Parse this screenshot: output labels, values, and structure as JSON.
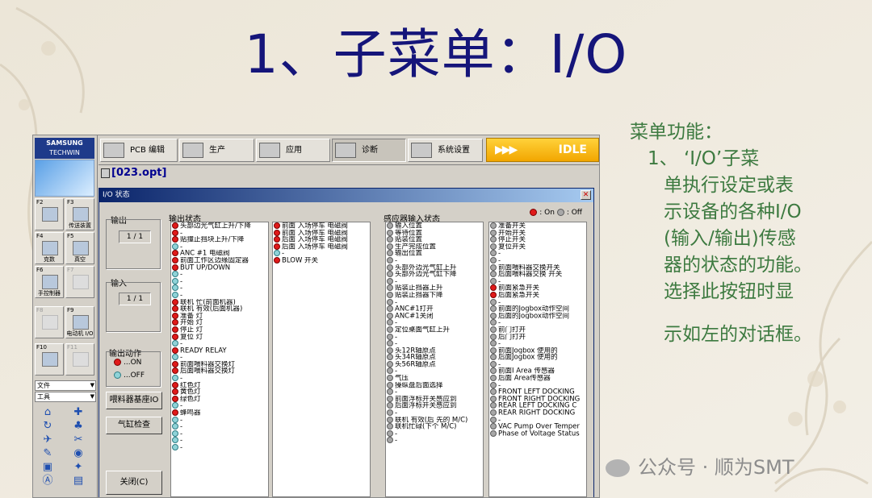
{
  "slide": {
    "title": "1、子菜单：I/O",
    "note_heading": "菜单功能：",
    "note_lines": [
      "1、 ‘I/O’子菜",
      "单执行设定或表",
      "示设备的各种I/O",
      "(输入/输出)传感",
      "器的状态的功能。",
      "选择此按钮时显",
      "示如左的对话框。"
    ],
    "watermark": "公众号 · 顺为SMT"
  },
  "app": {
    "logo_brand": "SAMSUNG",
    "logo_sub": "TECHWIN",
    "file_name": "[023.opt]",
    "status": "IDLE",
    "toolbar": [
      {
        "label": "PCB 编辑",
        "icon": "pcb-edit-icon"
      },
      {
        "label": "生产",
        "icon": "production-icon"
      },
      {
        "label": "应用",
        "icon": "application-icon"
      },
      {
        "label": "诊断",
        "icon": "diagnosis-icon",
        "active": true
      },
      {
        "label": "系统设置",
        "icon": "system-settings-icon"
      }
    ],
    "fkeys": [
      {
        "key": "F2",
        "label": "",
        "disabled": false
      },
      {
        "key": "F3",
        "label": "传送装置",
        "disabled": false
      },
      {
        "key": "F4",
        "label": "克数",
        "disabled": false
      },
      {
        "key": "F5",
        "label": "真空",
        "disabled": false
      },
      {
        "key": "F6",
        "label": "手控制器",
        "disabled": false
      },
      {
        "key": "F7",
        "label": "",
        "disabled": true
      },
      {
        "key": "F8",
        "label": "",
        "disabled": true
      },
      {
        "key": "F9",
        "label": "电动机 I/O",
        "disabled": false
      },
      {
        "key": "F10",
        "label": "",
        "disabled": false
      },
      {
        "key": "F11",
        "label": "",
        "disabled": true
      }
    ],
    "menu_file": "文件",
    "menu_tools": "工具"
  },
  "dialog": {
    "title": "I/O 状态",
    "legend_on": ": On",
    "legend_off": ": Off",
    "output_label": "输出",
    "output_count": "1 / 1",
    "input_label": "输入",
    "input_count": "1 / 1",
    "output_action_label": "输出动作",
    "action_on": "...ON",
    "action_off": "...OFF",
    "feeder_btn": "喂料器基座IO",
    "cylinder_btn": "气缸检查",
    "close_btn": "关闭(C)",
    "output_status_label": "输出状态",
    "sensor_status_label": "感应器输入状态",
    "output_col1": [
      [
        "头部边光气缸上升/下降",
        "on"
      ],
      [
        "-",
        "on"
      ],
      [
        "贴撞止挡块上升/下降",
        "on"
      ],
      [
        "-",
        "off"
      ],
      [
        "ANC #1 电磁阀",
        "on"
      ],
      [
        "前面工作区边缘固定器",
        "on"
      ],
      [
        "BUT UP/DOWN",
        "on"
      ],
      [
        "-",
        "off"
      ],
      [
        "-",
        "off"
      ],
      [
        "-",
        "off"
      ],
      [
        "-",
        "off"
      ],
      [
        "联机 忙(前面机器)",
        "on"
      ],
      [
        "联机 有效(后面机器)",
        "on"
      ],
      [
        "准备 灯",
        "on"
      ],
      [
        "开始 灯",
        "on"
      ],
      [
        "停止 灯",
        "on"
      ],
      [
        "复位 灯",
        "on"
      ],
      [
        "-",
        "off"
      ],
      [
        "READY RELAY",
        "on"
      ],
      [
        "-",
        "off"
      ],
      [
        "前面喂料器交换灯",
        "on"
      ],
      [
        "后面喂料器交换灯",
        "on"
      ],
      [
        "-",
        "off"
      ],
      [
        "红色灯",
        "on"
      ],
      [
        "黄色灯",
        "on"
      ],
      [
        "绿色灯",
        "on"
      ],
      [
        "-",
        "off"
      ],
      [
        "蜂鸣器",
        "on"
      ],
      [
        "-",
        "off"
      ],
      [
        "-",
        "off"
      ],
      [
        "-",
        "off"
      ],
      [
        "-",
        "off"
      ],
      [
        "-",
        "off"
      ]
    ],
    "output_col2": [
      [
        "前面 入场停车 电磁阀",
        "on"
      ],
      [
        "前面 入场停车 电磁阀",
        "on"
      ],
      [
        "后面 入场停车 电磁阀",
        "on"
      ],
      [
        "后面 入场停车 电磁阀",
        "on"
      ],
      [
        "-",
        "off"
      ],
      [
        "BLOW 开关",
        "on"
      ]
    ],
    "sensor_col1": [
      [
        "输入位置",
        "gray"
      ],
      [
        "等待位置",
        "gray"
      ],
      [
        "贴装位置",
        "gray"
      ],
      [
        "生产完成位置",
        "gray"
      ],
      [
        "输出位置",
        "gray"
      ],
      [
        "-",
        "gray"
      ],
      [
        "头部外边光气缸上升",
        "gray"
      ],
      [
        "头部外边光气缸下降",
        "gray"
      ],
      [
        "-",
        "gray"
      ],
      [
        "贴装止挡器上升",
        "gray"
      ],
      [
        "贴装止挡器下降",
        "gray"
      ],
      [
        "-",
        "gray"
      ],
      [
        "ANC#1打开",
        "gray"
      ],
      [
        "ANC#1关闭",
        "gray"
      ],
      [
        "-",
        "gray"
      ],
      [
        "定位桌面气缸上升",
        "gray"
      ],
      [
        "-",
        "gray"
      ],
      [
        "-",
        "gray"
      ],
      [
        "头12R轴原点",
        "gray"
      ],
      [
        "头34R轴原点",
        "gray"
      ],
      [
        "头56R轴原点",
        "gray"
      ],
      [
        "-",
        "gray"
      ],
      [
        "气压",
        "gray"
      ],
      [
        "操纵盘后面选择",
        "gray"
      ],
      [
        "-",
        "gray"
      ],
      [
        "前面浮标开关感应到",
        "gray"
      ],
      [
        "后面浮标开关感应到",
        "gray"
      ],
      [
        "-",
        "gray"
      ],
      [
        "联机 有效(后 先的 M/C)",
        "gray"
      ],
      [
        "联机忙碌(下个 M/C)",
        "gray"
      ],
      [
        "-",
        "gray"
      ],
      [
        "-",
        "gray"
      ]
    ],
    "sensor_col2": [
      [
        "准备开关",
        "gray"
      ],
      [
        "开始开关",
        "gray"
      ],
      [
        "停止开关",
        "gray"
      ],
      [
        "复位开关",
        "gray"
      ],
      [
        "-",
        "gray"
      ],
      [
        "-",
        "gray"
      ],
      [
        "前面喂料器交换开关",
        "gray"
      ],
      [
        "后面喂料器交换 开关",
        "gray"
      ],
      [
        "-",
        "gray"
      ],
      [
        "前面紧急开关",
        "on"
      ],
      [
        "后面紧急开关",
        "on"
      ],
      [
        "-",
        "gray"
      ],
      [
        "前面的Jogbox动作空间",
        "gray"
      ],
      [
        "后面的Jogbox动作空间",
        "gray"
      ],
      [
        "-",
        "gray"
      ],
      [
        "前门打开",
        "gray"
      ],
      [
        "后门打开",
        "gray"
      ],
      [
        "-",
        "gray"
      ],
      [
        "前面Jogbox 使用的",
        "gray"
      ],
      [
        "后面Jogbox 使用的",
        "gray"
      ],
      [
        "-",
        "gray"
      ],
      [
        "前面I Area 传感器",
        "gray"
      ],
      [
        "后面 Area传感器",
        "gray"
      ],
      [
        "-",
        "gray"
      ],
      [
        "FRONT LEFT DOCKING",
        "gray"
      ],
      [
        "FRONT RIGHT DOCKING",
        "gray"
      ],
      [
        "REAR LEFT DOCKING C",
        "gray"
      ],
      [
        "REAR RIGHT DOCKING",
        "gray"
      ],
      [
        "-",
        "gray"
      ],
      [
        "VAC Pump Over Temper",
        "gray"
      ],
      [
        "Phase of Voltage Status",
        "gray"
      ]
    ]
  }
}
